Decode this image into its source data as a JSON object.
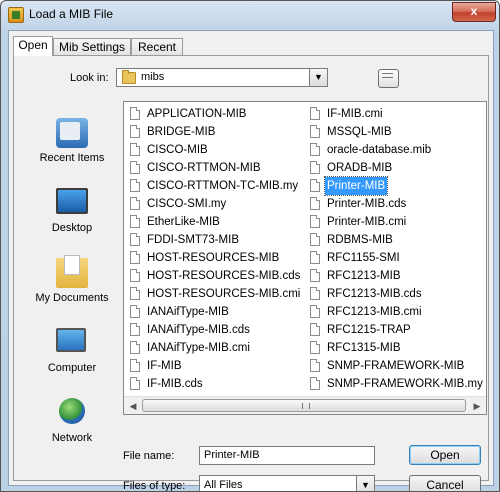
{
  "window": {
    "title": "Load a MIB File",
    "close_label": "x"
  },
  "tabs": [
    {
      "label": "Open",
      "active": true
    },
    {
      "label": "Mib Settings",
      "active": false
    },
    {
      "label": "Recent",
      "active": false
    }
  ],
  "look_in": {
    "label": "Look in:",
    "value": "mibs",
    "arrow": "▼"
  },
  "places": [
    {
      "label": "Recent Items",
      "icon": "recent-items-icon"
    },
    {
      "label": "Desktop",
      "icon": "desktop-icon"
    },
    {
      "label": "My Documents",
      "icon": "my-documents-icon"
    },
    {
      "label": "Computer",
      "icon": "computer-icon"
    },
    {
      "label": "Network",
      "icon": "network-icon"
    }
  ],
  "files": {
    "column1": [
      "APPLICATION-MIB",
      "BRIDGE-MIB",
      "CISCO-MIB",
      "CISCO-RTTMON-MIB",
      "CISCO-RTTMON-TC-MIB.my",
      "CISCO-SMI.my",
      "EtherLike-MIB",
      "FDDI-SMT73-MIB",
      "HOST-RESOURCES-MIB",
      "HOST-RESOURCES-MIB.cds",
      "HOST-RESOURCES-MIB.cmi",
      "IANAifType-MIB",
      "IANAifType-MIB.cds",
      "IANAifType-MIB.cmi",
      "IF-MIB",
      "IF-MIB.cds"
    ],
    "column2": [
      "IF-MIB.cmi",
      "MSSQL-MIB",
      "oracle-database.mib",
      "ORADB-MIB",
      "Printer-MIB",
      "Printer-MIB.cds",
      "Printer-MIB.cmi",
      "RDBMS-MIB",
      "RFC1155-SMI",
      "RFC1213-MIB",
      "RFC1213-MIB.cds",
      "RFC1213-MIB.cmi",
      "RFC1215-TRAP",
      "RFC1315-MIB",
      "SNMP-FRAMEWORK-MIB",
      "SNMP-FRAMEWORK-MIB.my"
    ],
    "selected": "Printer-MIB"
  },
  "scrollbar": {
    "left_arrow": "◀",
    "right_arrow": "▶"
  },
  "file_name": {
    "label": "File name:",
    "value": "Printer-MIB"
  },
  "file_type": {
    "label": "Files of type:",
    "value": "All Files",
    "arrow": "▼"
  },
  "buttons": {
    "open": "Open",
    "cancel": "Cancel"
  }
}
